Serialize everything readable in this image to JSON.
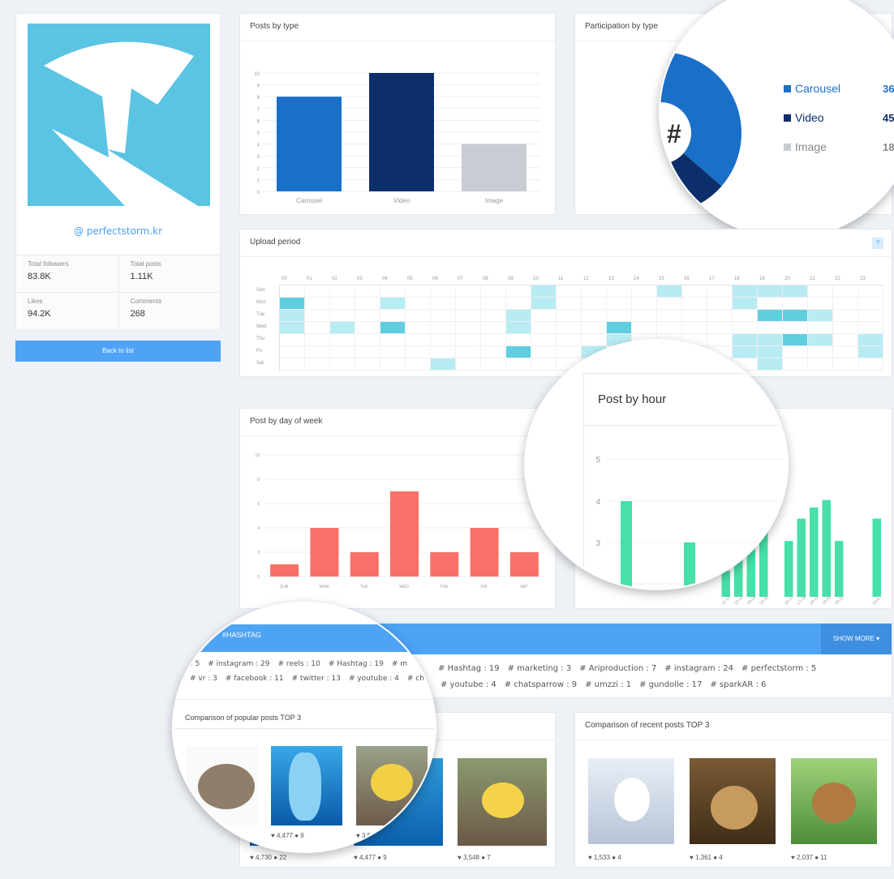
{
  "profile": {
    "handle": "@ perfectstorm.kr",
    "stats": [
      {
        "label": "Total followers",
        "value": "83.8K"
      },
      {
        "label": "Total posts",
        "value": "1.11K"
      },
      {
        "label": "Likes",
        "value": "94.2K"
      },
      {
        "label": "Comments",
        "value": "268"
      }
    ],
    "back_label": "Back to list"
  },
  "posts_by_type": {
    "title": "Posts by type",
    "chart_data": {
      "type": "bar",
      "categories": [
        "Carousel",
        "Video",
        "Image"
      ],
      "values": [
        8,
        10,
        4
      ],
      "ylim": [
        0,
        10
      ],
      "ticks": [
        "10",
        "9",
        "8",
        "7",
        "6",
        "5",
        "4",
        "3",
        "2",
        "1",
        "0"
      ],
      "colors": [
        "#1a6fc8",
        "#0c2f6b",
        "#c9ccd2"
      ]
    }
  },
  "participation": {
    "title": "Participation by type",
    "center_icon": "hashtag-icon",
    "chart_data": {
      "type": "pie",
      "labels": [
        "Carousel",
        "Video",
        "Image"
      ],
      "values": [
        36,
        45,
        18
      ],
      "value_labels": [
        "36%",
        "45%",
        "18%"
      ],
      "colors": [
        "#1a6fc8",
        "#0c2f6b",
        "#c9ccd2"
      ]
    }
  },
  "upload": {
    "title": "Upload period",
    "help": "?",
    "hours": [
      "00",
      "01",
      "02",
      "03",
      "04",
      "05",
      "06",
      "07",
      "08",
      "09",
      "10",
      "11",
      "12",
      "13",
      "14",
      "15",
      "16",
      "17",
      "18",
      "19",
      "20",
      "21",
      "22",
      "23"
    ],
    "days": [
      "Sun",
      "Mon",
      "Tue",
      "Wed",
      "Thu",
      "Fri",
      "Sat"
    ],
    "cells": [
      [
        0,
        10
      ],
      [
        0,
        15
      ],
      [
        0,
        18
      ],
      [
        0,
        19
      ],
      [
        0,
        20
      ],
      [
        1,
        0,
        2
      ],
      [
        1,
        4
      ],
      [
        1,
        10
      ],
      [
        1,
        18
      ],
      [
        2,
        0
      ],
      [
        2,
        9
      ],
      [
        2,
        19,
        2
      ],
      [
        2,
        20,
        2
      ],
      [
        2,
        21
      ],
      [
        3,
        0
      ],
      [
        3,
        2
      ],
      [
        3,
        4,
        2
      ],
      [
        3,
        9
      ],
      [
        3,
        13,
        2
      ],
      [
        4,
        13
      ],
      [
        4,
        18
      ],
      [
        4,
        19
      ],
      [
        4,
        20,
        2
      ],
      [
        4,
        21
      ],
      [
        4,
        23
      ],
      [
        5,
        9,
        2
      ],
      [
        5,
        12
      ],
      [
        5,
        18
      ],
      [
        5,
        19
      ],
      [
        5,
        23
      ],
      [
        6,
        6
      ],
      [
        6,
        19
      ]
    ]
  },
  "day_of_week": {
    "title": "Post by day of week",
    "chart_data": {
      "type": "bar",
      "categories": [
        "SUN",
        "MON",
        "TUE",
        "WED",
        "THU",
        "FRI",
        "SAT"
      ],
      "values": [
        1,
        4,
        2,
        7,
        2,
        4,
        2
      ],
      "ylim": [
        0,
        10
      ],
      "ticks": [
        "10",
        "8",
        "6",
        "4",
        "2",
        "0"
      ],
      "color": "#f87068"
    }
  },
  "by_hour": {
    "title": "Post by hour",
    "chart_data": {
      "type": "bar",
      "categories": [
        "0-1",
        "1-2",
        "2-3",
        "3-4",
        "4-5",
        "5-6",
        "6-7",
        "7-8",
        "8-9",
        "9-10",
        "10-11",
        "11-12",
        "12-13",
        "13-14",
        "14-15",
        "15-16",
        "16-17",
        "17-18",
        "18-19",
        "19-20",
        "20-21",
        "21-22",
        "22-23",
        "23-0"
      ],
      "values": [
        4,
        0,
        0,
        0,
        3,
        0,
        0,
        0,
        0,
        0,
        0,
        2,
        2.7,
        2.7,
        3.1,
        0,
        2.8,
        3.4,
        3.7,
        3.9,
        2.8,
        0,
        0,
        3.4
      ],
      "ticks": [
        "5",
        "4",
        "3",
        "2"
      ],
      "color": "#46e0a8"
    }
  },
  "hashtag": {
    "title": "#HASHTAG",
    "show_more": "SHOW MORE",
    "row1": [
      "# Hashtag : 19",
      "# marketing : 3",
      "# Ariproduction : 7",
      "# instagram : 24",
      "# perfectstorm : 5"
    ],
    "row2": [
      "# youtube : 4",
      "# chatsparrow : 9",
      "# umzzi : 1",
      "# gundolle : 17",
      "# sparkAR : 6"
    ],
    "zoom_row1": [
      "r : 5",
      "# instagram : 29",
      "# reels : 10",
      "# Hashtag : 19",
      "# m"
    ],
    "zoom_row2": [
      "# vr : 3",
      "# facebook : 11",
      "# twitter : 13",
      "# youtube : 4",
      "# chats"
    ]
  },
  "popular": {
    "title": "Comparison of popular posts TOP 3",
    "captions": [
      "♥ 4,730 ● 22",
      "♥ 4,477 ● 9",
      "♥ 3,548 ● 7"
    ],
    "zoom_captions": [
      "♥ 4,477 ● 9",
      "♥ 3,548 ● 7"
    ]
  },
  "recent": {
    "title": "Comparison of recent posts TOP 3",
    "captions": [
      "♥ 1,533 ● 4",
      "♥ 1,361 ● 4",
      "♥ 2,037 ● 11"
    ]
  }
}
